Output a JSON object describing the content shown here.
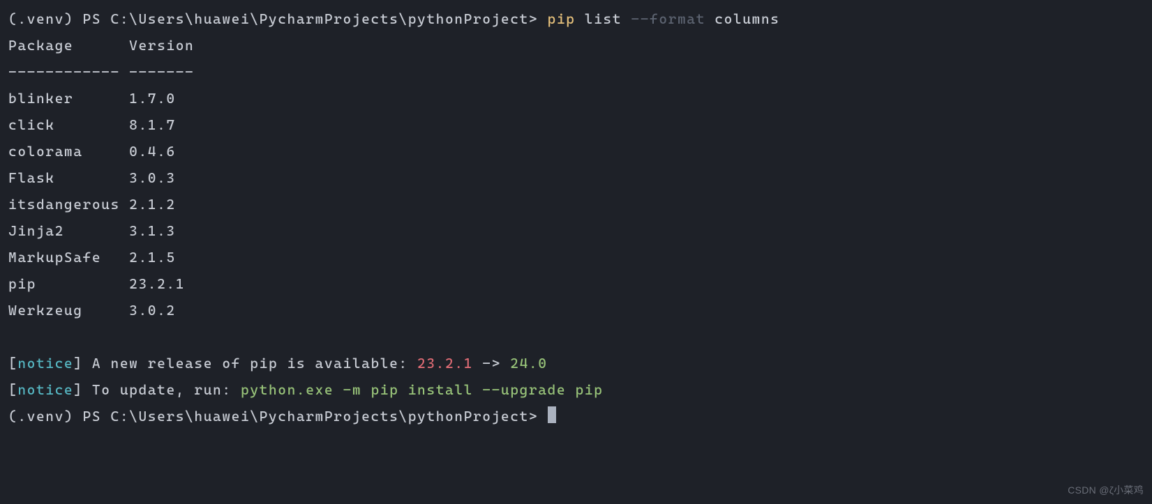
{
  "prompt1": {
    "prefix": "(.venv) PS C:\\Users\\huawei\\PycharmProjects\\pythonProject> ",
    "cmd_pip": "pip",
    "cmd_list": " list ",
    "cmd_flag": "--format",
    "cmd_arg": " columns"
  },
  "header": {
    "package": "Package     ",
    "version": " Version",
    "divider": "------------ -------"
  },
  "packages": [
    {
      "name": "blinker     ",
      "version": " 1.7.0"
    },
    {
      "name": "click       ",
      "version": " 8.1.7"
    },
    {
      "name": "colorama    ",
      "version": " 0.4.6"
    },
    {
      "name": "Flask       ",
      "version": " 3.0.3"
    },
    {
      "name": "itsdangerous",
      "version": " 2.1.2"
    },
    {
      "name": "Jinja2      ",
      "version": " 3.1.3"
    },
    {
      "name": "MarkupSafe  ",
      "version": " 2.1.5"
    },
    {
      "name": "pip         ",
      "version": " 23.2.1"
    },
    {
      "name": "Werkzeug    ",
      "version": " 3.0.2"
    }
  ],
  "notice1": {
    "bracket_open": "[",
    "label": "notice",
    "bracket_close": "] ",
    "msg": "A new release of pip is available: ",
    "old_ver": "23.2.1",
    "arrow": " -> ",
    "new_ver": "24.0"
  },
  "notice2": {
    "bracket_open": "[",
    "label": "notice",
    "bracket_close": "] ",
    "msg": "To update, run: ",
    "cmd": "python.exe -m pip install --upgrade pip"
  },
  "prompt2": {
    "prefix": "(.venv) PS C:\\Users\\huawei\\PycharmProjects\\pythonProject> "
  },
  "watermark": "CSDN @ζ小菜鸡"
}
